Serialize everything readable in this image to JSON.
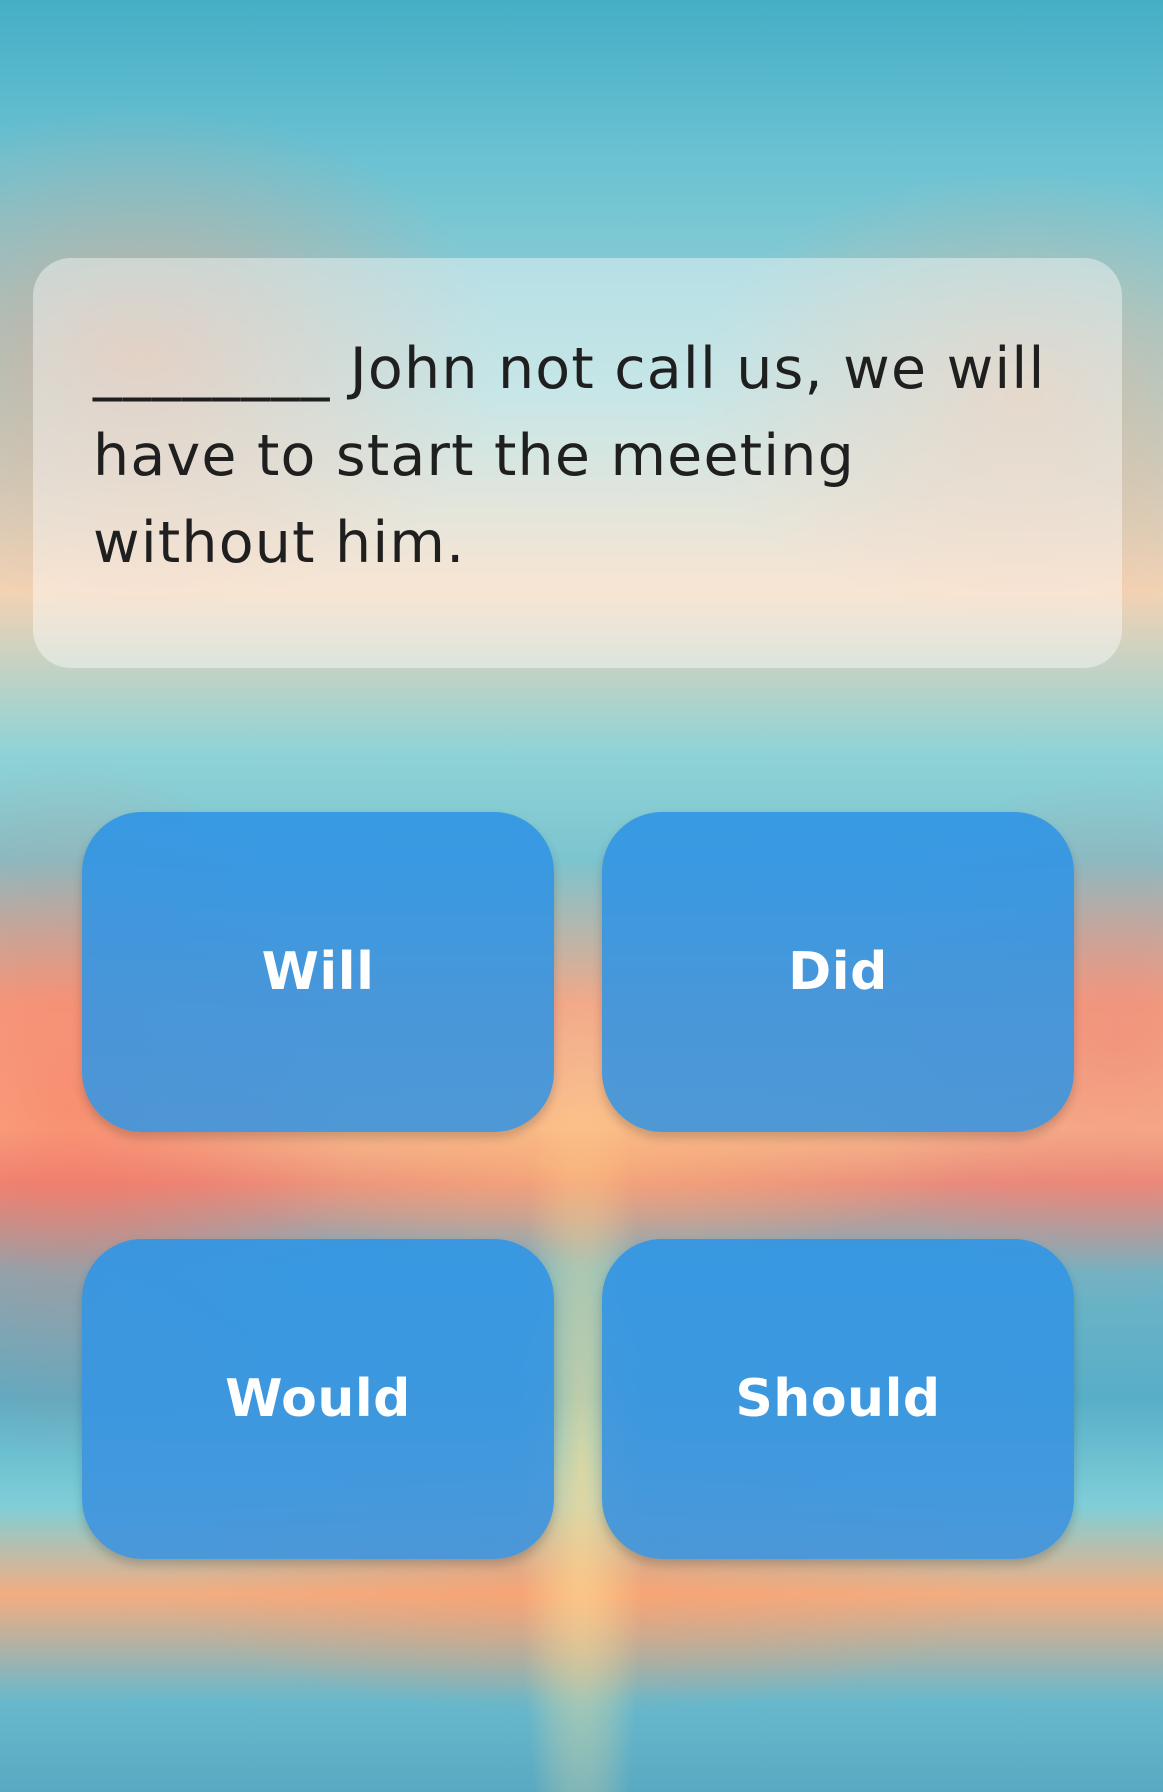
{
  "question": {
    "text": "________ John not call us, we will have to start the meeting without him."
  },
  "answers": [
    {
      "label": "Will"
    },
    {
      "label": "Did"
    },
    {
      "label": "Would"
    },
    {
      "label": "Should"
    }
  ],
  "colors": {
    "button": "#3896E4",
    "button_text": "#FFFFFF",
    "question_text": "#1F1F1F"
  }
}
